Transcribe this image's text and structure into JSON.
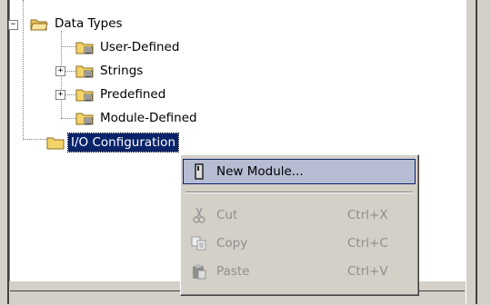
{
  "tree": {
    "items": [
      {
        "label": "Data Types",
        "expander": "−"
      },
      {
        "label": "User-Defined"
      },
      {
        "label": "Strings",
        "expander": "+"
      },
      {
        "label": "Predefined",
        "expander": "+"
      },
      {
        "label": "Module-Defined"
      },
      {
        "label": "I/O Configuration"
      }
    ]
  },
  "context_menu": {
    "items": [
      {
        "label": "New Module...",
        "shortcut": "",
        "icon": "module-icon",
        "enabled": true,
        "highlighted": true
      },
      {
        "label": "Cut",
        "shortcut": "Ctrl+X",
        "icon": "scissors-icon",
        "enabled": false
      },
      {
        "label": "Copy",
        "shortcut": "Ctrl+C",
        "icon": "copy-icon",
        "enabled": false
      },
      {
        "label": "Paste",
        "shortcut": "Ctrl+V",
        "icon": "paste-icon",
        "enabled": false
      }
    ]
  },
  "colors": {
    "selection": "#0a246a",
    "menu_highlight": "#b6bdd2",
    "face": "#d4d0c8",
    "folder": "#f4d46a"
  }
}
